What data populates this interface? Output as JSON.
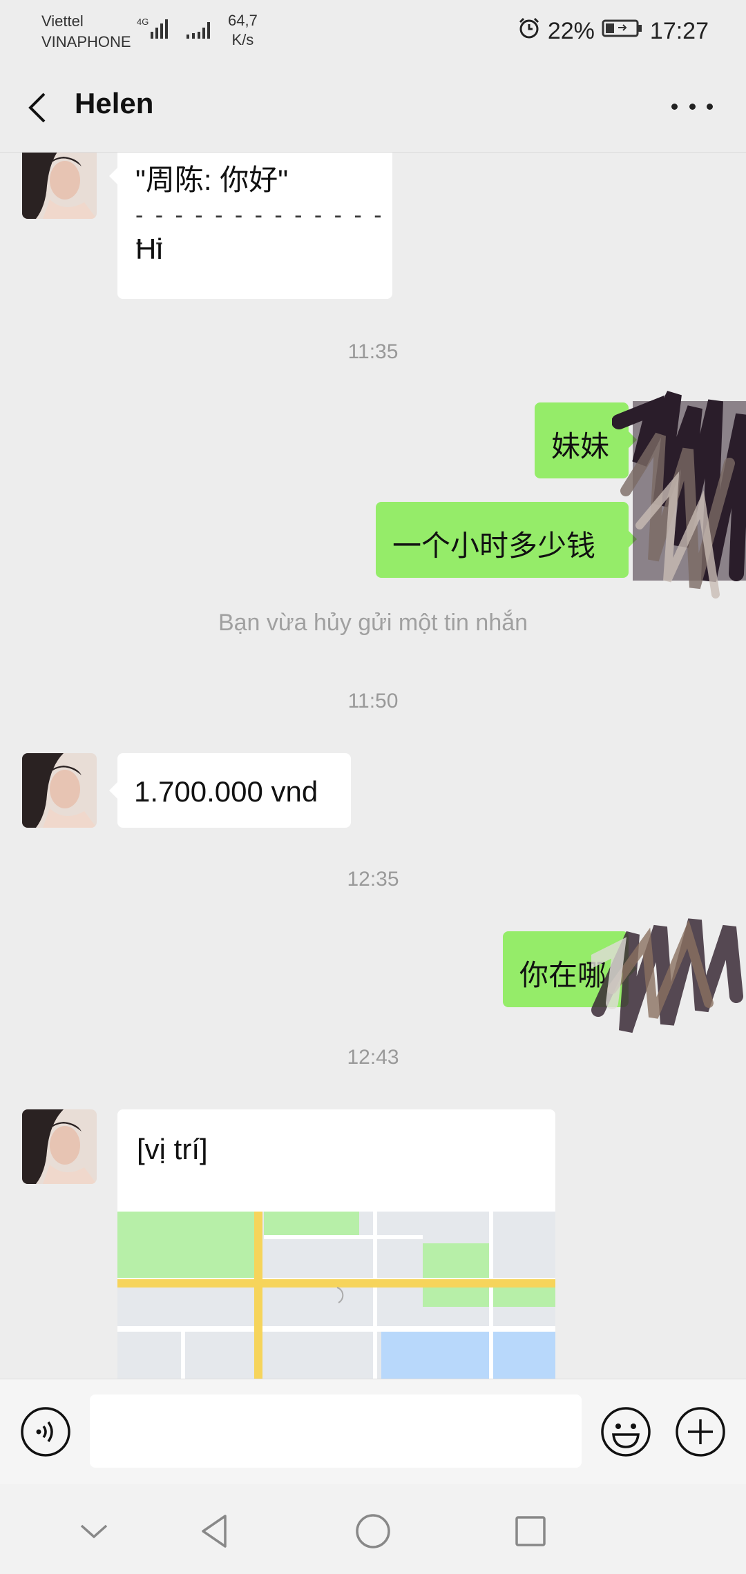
{
  "status_bar": {
    "carrier_1": "Viettel",
    "carrier_2": "VINAPHONE",
    "speed_value": "64,7",
    "speed_unit": "K/s",
    "battery": "22%",
    "time": "17:27",
    "network_type": "4G"
  },
  "header": {
    "title": "Helen"
  },
  "messages": {
    "quoted": {
      "quote_line": "\"周陈: 你好\"",
      "divider": "- - - - - - - - - - - - - - -",
      "reply": "Hi"
    },
    "time_1": "11:35",
    "me_1": "妹妹",
    "me_2": "一个小时多少钱",
    "recall_notice": "Bạn vừa hủy gửi một tin nhắn",
    "time_2": "11:50",
    "them_price": "1.700.000 vnd",
    "time_3": "12:35",
    "me_3": "你在哪",
    "time_4": "12:43",
    "location_label": "[vị trí]"
  },
  "input": {
    "placeholder": ""
  },
  "colors": {
    "background": "#ededed",
    "my_bubble": "#95ec69",
    "their_bubble": "#ffffff",
    "map_green": "#b7efa8",
    "map_road": "#f6d45b",
    "map_water": "#b8d8fb"
  },
  "icons": {
    "back": "chevron-left-icon",
    "more": "more-dots-icon",
    "voice": "voice-icon",
    "emoji": "emoji-icon",
    "plus": "plus-icon",
    "nav_down": "chevron-down-icon",
    "nav_back": "triangle-back-icon",
    "nav_home": "circle-home-icon",
    "nav_recent": "square-recent-icon"
  }
}
